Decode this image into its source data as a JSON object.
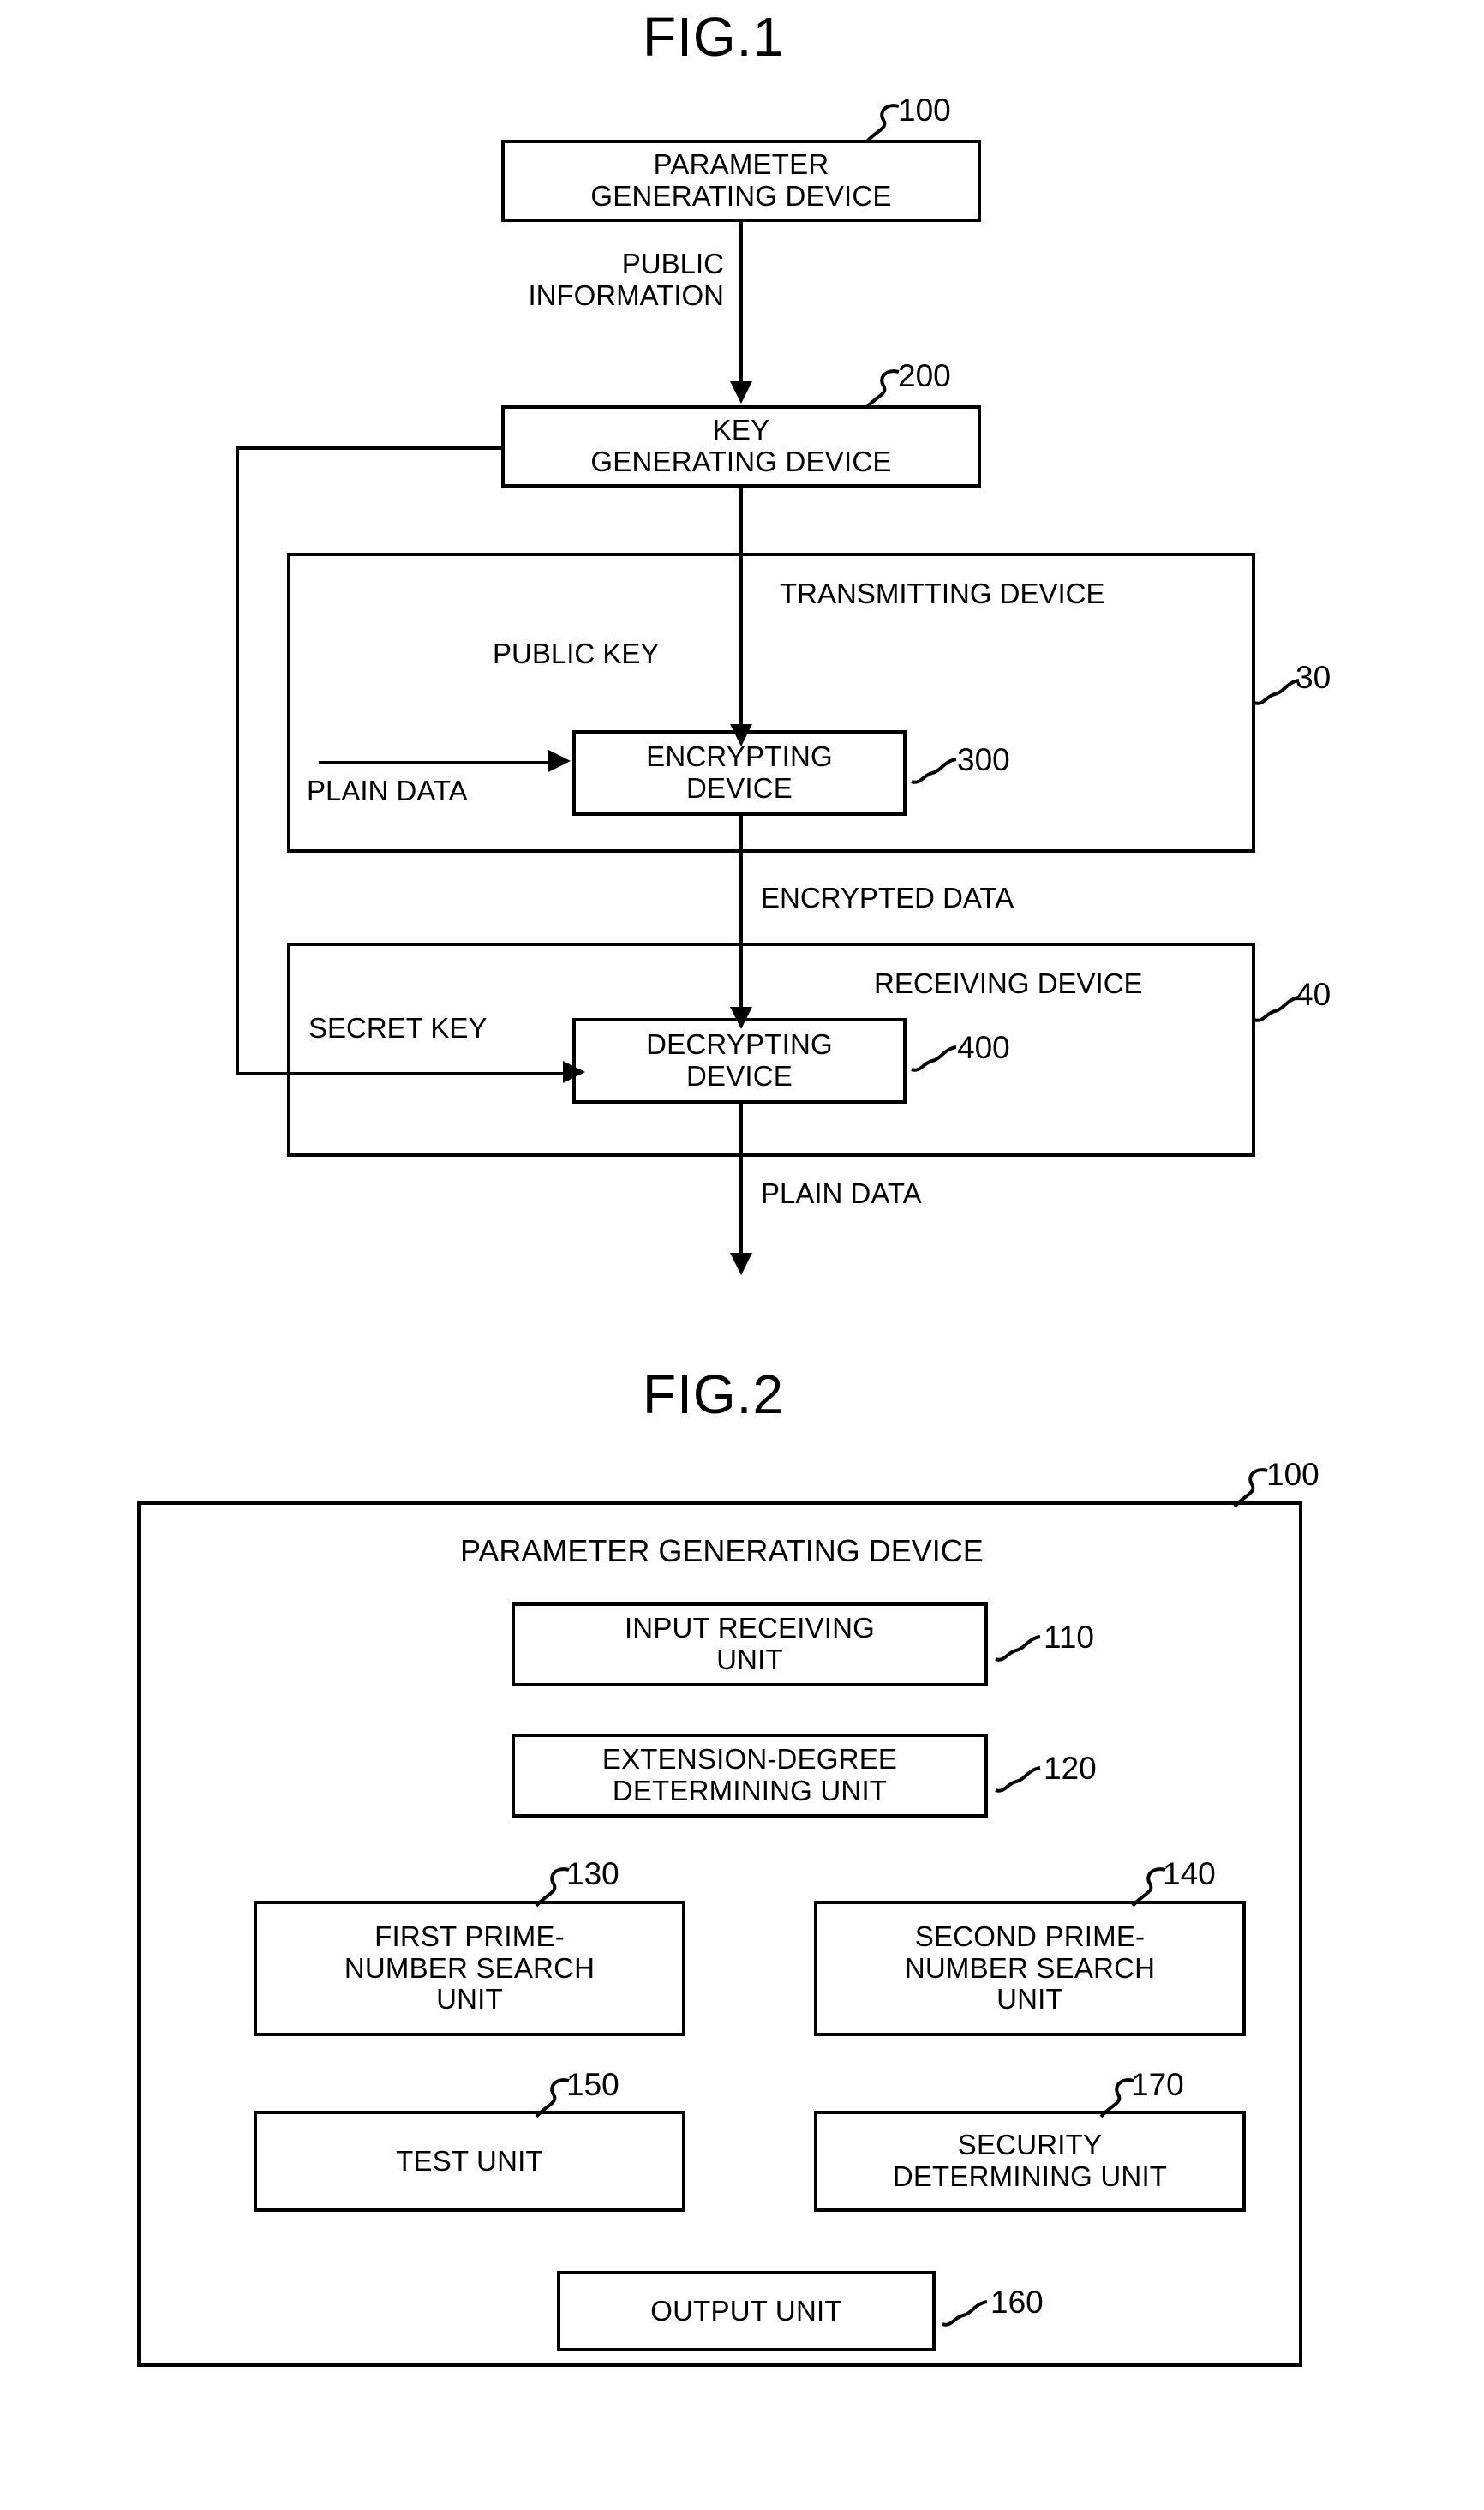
{
  "figures": [
    {
      "title": "FIG.1",
      "ref_top": "100",
      "blocks": {
        "parameter_generating_device": "PARAMETER\nGENERATING DEVICE",
        "parameter_generating_device_l1": "PARAMETER",
        "parameter_generating_device_l2": "GENERATING DEVICE",
        "key_generating_device_l1": "KEY",
        "key_generating_device_l2": "GENERATING DEVICE",
        "encrypting_device_l1": "ENCRYPTING",
        "encrypting_device_l2": "DEVICE",
        "decrypting_device_l1": "DECRYPTING",
        "decrypting_device_l2": "DEVICE",
        "transmitting_device": "TRANSMITTING DEVICE",
        "receiving_device": "RECEIVING DEVICE"
      },
      "flow_labels": {
        "public_information_l1": "PUBLIC",
        "public_information_l2": "INFORMATION",
        "public_key": "PUBLIC KEY",
        "plain_data_in": "PLAIN DATA",
        "encrypted_data": "ENCRYPTED DATA",
        "secret_key": "SECRET KEY",
        "plain_data_out": "PLAIN DATA"
      },
      "refs": {
        "parameter_generating_device": "100",
        "key_generating_device": "200",
        "transmitting_device": "30",
        "encrypting_device": "300",
        "receiving_device": "40",
        "decrypting_device": "400"
      }
    },
    {
      "title": "FIG.2",
      "frame_ref": "100",
      "frame_title": "PARAMETER GENERATING DEVICE",
      "units": [
        {
          "label_l1": "INPUT RECEIVING",
          "label_l2": "UNIT",
          "ref": "110"
        },
        {
          "label_l1": "EXTENSION-DEGREE",
          "label_l2": "DETERMINING UNIT",
          "ref": "120"
        },
        {
          "label_l1": "FIRST PRIME-",
          "label_l2": "NUMBER SEARCH",
          "label_l3": "UNIT",
          "ref": "130"
        },
        {
          "label_l1": "SECOND PRIME-",
          "label_l2": "NUMBER SEARCH",
          "label_l3": "UNIT",
          "ref": "140"
        },
        {
          "label_l1": "TEST UNIT",
          "label_l2": "",
          "ref": "150"
        },
        {
          "label_l1": "SECURITY",
          "label_l2": "DETERMINING UNIT",
          "ref": "170"
        },
        {
          "label_l1": "OUTPUT UNIT",
          "label_l2": "",
          "ref": "160"
        }
      ]
    }
  ],
  "colors": {
    "ink": "#000000",
    "paper": "#ffffff"
  }
}
